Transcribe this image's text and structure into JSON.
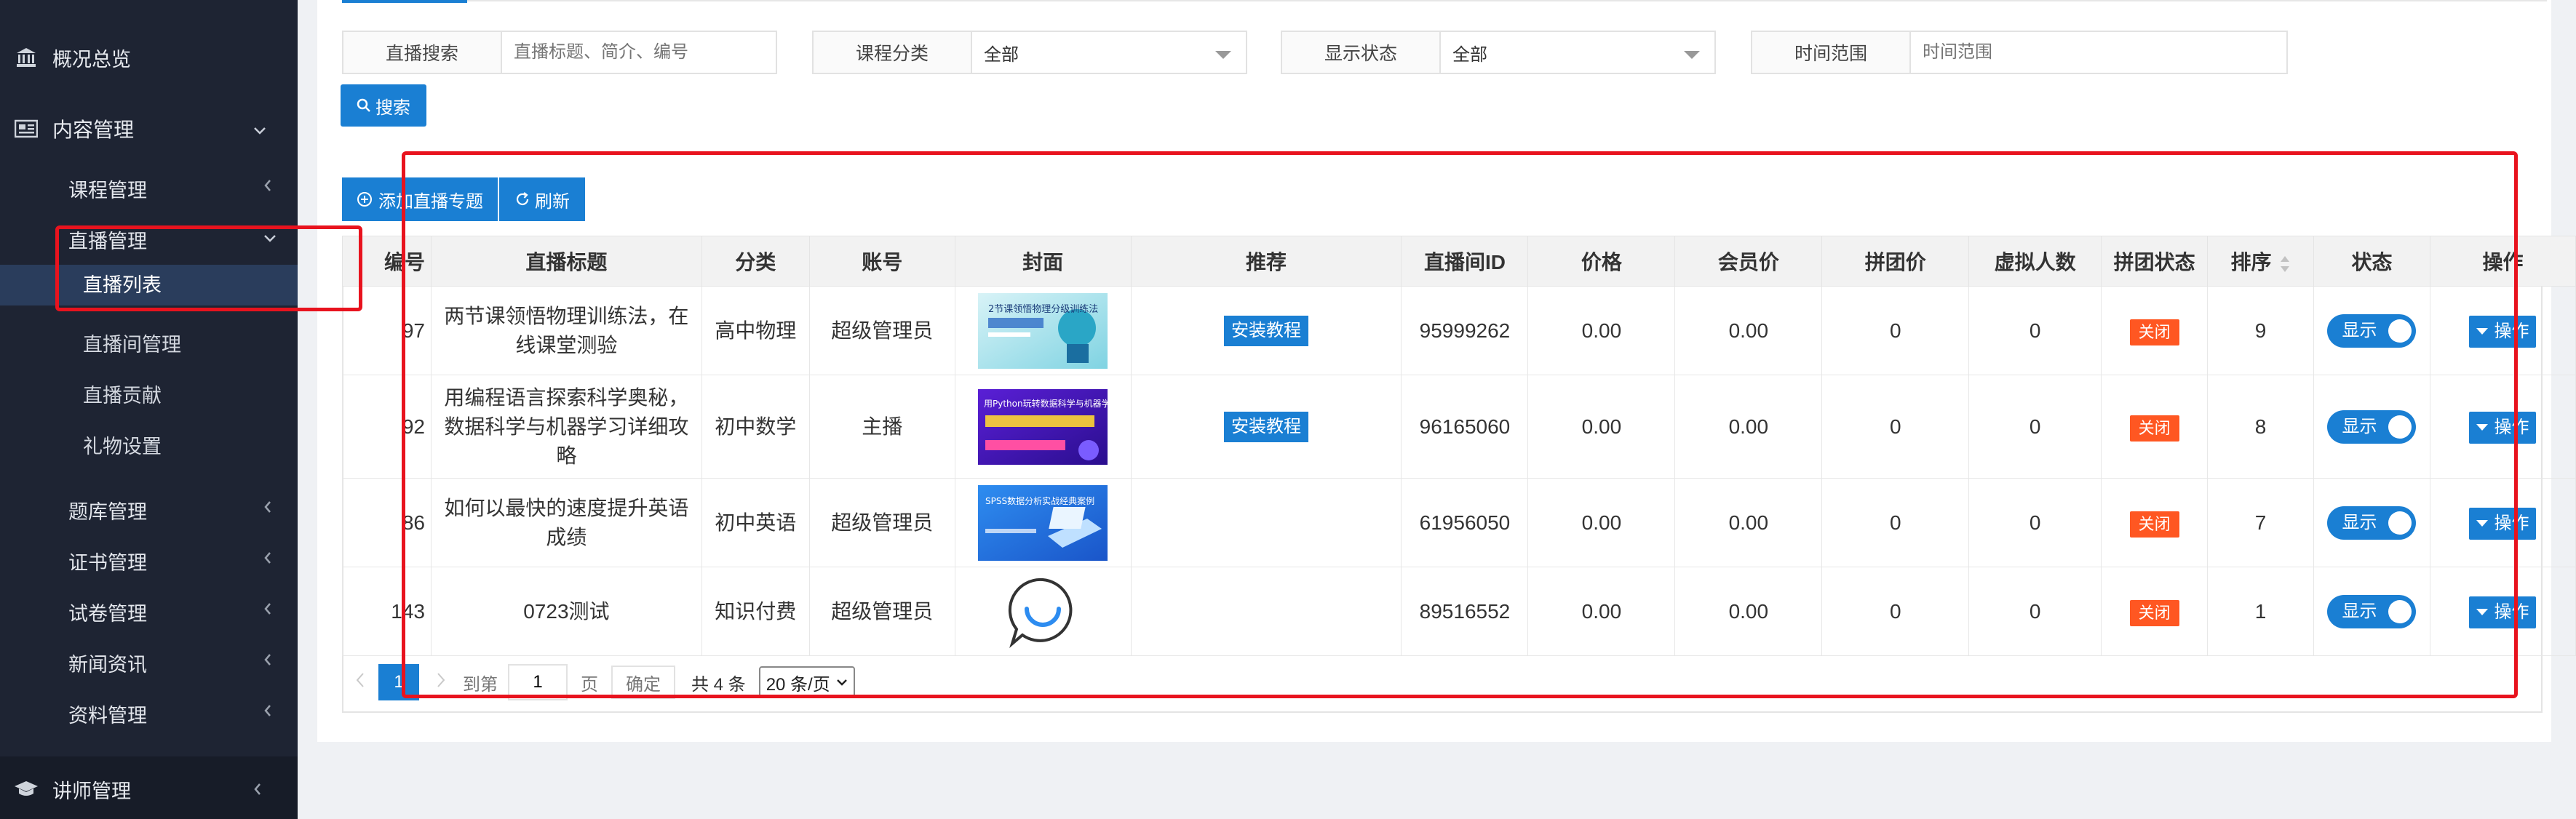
{
  "sidebar": {
    "overview": "概况总览",
    "content_mgmt": "内容管理",
    "items": [
      "课程管理",
      "直播管理"
    ],
    "live_sub": [
      "直播列表",
      "直播间管理",
      "直播贡献",
      "礼物设置"
    ],
    "more_items": [
      "题库管理",
      "证书管理",
      "试卷管理",
      "新闻资讯",
      "资料管理"
    ],
    "lecturer": "讲师管理"
  },
  "filters": {
    "search_label": "直播搜索",
    "search_placeholder": "直播标题、简介、编号",
    "category_label": "课程分类",
    "category_value": "全部",
    "status_label": "显示状态",
    "status_value": "全部",
    "time_label": "时间范围",
    "time_placeholder": "时间范围",
    "search_button": "搜索"
  },
  "toolbar": {
    "add": "添加直播专题",
    "refresh": "刷新"
  },
  "table": {
    "headers": [
      "编号",
      "直播标题",
      "分类",
      "账号",
      "封面",
      "推荐",
      "直播间ID",
      "价格",
      "会员价",
      "拼团价",
      "虚拟人数",
      "拼团状态",
      "排序",
      "状态",
      "操作"
    ],
    "rows": [
      {
        "id": "97",
        "title": "两节课领悟物理训练法，在线课堂测验",
        "category": "高中物理",
        "account": "超级管理员",
        "cover": "2节课领悟物理分级训练法",
        "recommend": "安装教程",
        "room_id": "95999262",
        "price": "0.00",
        "member_price": "0.00",
        "group_price": "0",
        "virtual": "0",
        "group_status": "关闭",
        "sort": "9",
        "status": "显示",
        "op": "操作"
      },
      {
        "id": "92",
        "title": "用编程语言探索科学奥秘，数据科学与机器学习详细攻略",
        "category": "初中数学",
        "account": "主播",
        "cover": "用Python玩转数据科学与机器学习",
        "recommend": "安装教程",
        "room_id": "96165060",
        "price": "0.00",
        "member_price": "0.00",
        "group_price": "0",
        "virtual": "0",
        "group_status": "关闭",
        "sort": "8",
        "status": "显示",
        "op": "操作"
      },
      {
        "id": "86",
        "title": "如何以最快的速度提升英语成绩",
        "category": "初中英语",
        "account": "超级管理员",
        "cover": "SPSS数据分析实战经典案例",
        "recommend": "",
        "room_id": "61956050",
        "price": "0.00",
        "member_price": "0.00",
        "group_price": "0",
        "virtual": "0",
        "group_status": "关闭",
        "sort": "7",
        "status": "显示",
        "op": "操作"
      },
      {
        "id": "143",
        "title": "0723测试",
        "category": "知识付费",
        "account": "超级管理员",
        "cover": "",
        "recommend": "",
        "room_id": "89516552",
        "price": "0.00",
        "member_price": "0.00",
        "group_price": "0",
        "virtual": "0",
        "group_status": "关闭",
        "sort": "1",
        "status": "显示",
        "op": "操作"
      }
    ]
  },
  "pager": {
    "current": "1",
    "goto": "到第",
    "page_input": "1",
    "page_unit": "页",
    "confirm": "确定",
    "total": "共 4 条",
    "per_page": "20 条/页"
  },
  "colors": {
    "primary": "#1a7fd3",
    "danger": "#ff5722",
    "sidebar": "#1e2433",
    "highlight": "#e8131e"
  }
}
